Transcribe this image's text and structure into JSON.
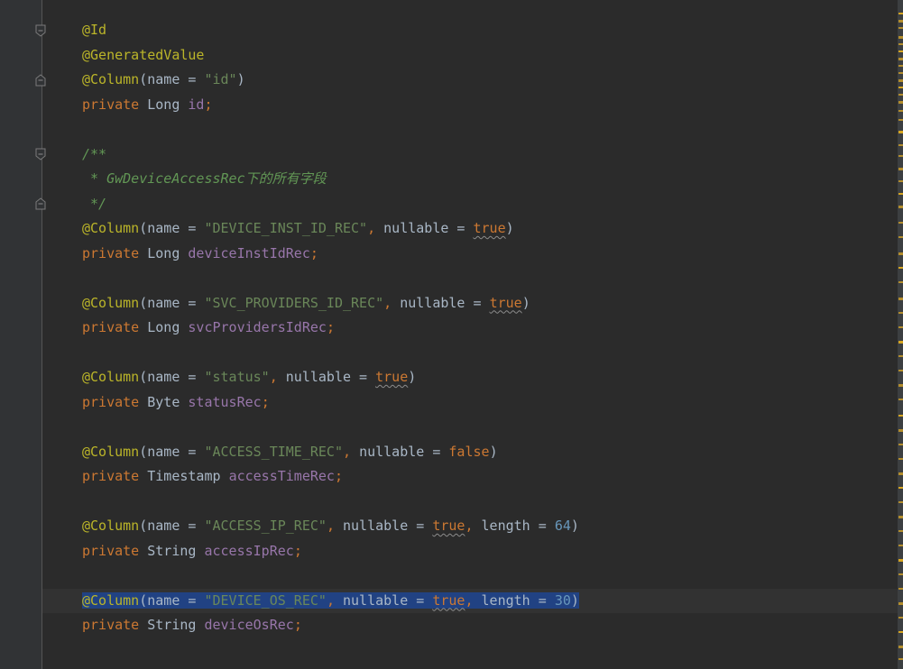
{
  "editor": {
    "lines": [
      {
        "caret": false,
        "tokens": [
          {
            "t": "@Id",
            "c": "ann"
          }
        ]
      },
      {
        "caret": false,
        "tokens": [
          {
            "t": "@GeneratedValue",
            "c": "ann"
          }
        ]
      },
      {
        "caret": false,
        "tokens": [
          {
            "t": "@Column",
            "c": "ann"
          },
          {
            "t": "(name = "
          },
          {
            "t": "\"id\"",
            "c": "str"
          },
          {
            "t": ")"
          }
        ]
      },
      {
        "caret": false,
        "tokens": [
          {
            "t": "private",
            "c": "kw"
          },
          {
            "t": " Long "
          },
          {
            "t": "id",
            "c": "fld"
          },
          {
            "t": ";",
            "c": "punc"
          }
        ]
      },
      {
        "caret": false,
        "tokens": []
      },
      {
        "caret": false,
        "tokens": [
          {
            "t": "/**",
            "c": "cmt"
          }
        ]
      },
      {
        "caret": false,
        "tokens": [
          {
            "t": " * GwDeviceAccessRec下的所有字段",
            "c": "cmt"
          }
        ]
      },
      {
        "caret": false,
        "tokens": [
          {
            "t": " */",
            "c": "cmt"
          }
        ]
      },
      {
        "caret": false,
        "tokens": [
          {
            "t": "@Column",
            "c": "ann"
          },
          {
            "t": "(name = "
          },
          {
            "t": "\"DEVICE_INST_ID_REC\"",
            "c": "str"
          },
          {
            "t": ", ",
            "c": "punc"
          },
          {
            "t": "nullable = "
          },
          {
            "t": "true",
            "c": "kw warn"
          },
          {
            "t": ")"
          }
        ]
      },
      {
        "caret": false,
        "tokens": [
          {
            "t": "private",
            "c": "kw"
          },
          {
            "t": " Long "
          },
          {
            "t": "deviceInstIdRec",
            "c": "fld"
          },
          {
            "t": ";",
            "c": "punc"
          }
        ]
      },
      {
        "caret": false,
        "tokens": []
      },
      {
        "caret": false,
        "tokens": [
          {
            "t": "@Column",
            "c": "ann"
          },
          {
            "t": "(name = "
          },
          {
            "t": "\"SVC_PROVIDERS_ID_REC\"",
            "c": "str"
          },
          {
            "t": ", ",
            "c": "punc"
          },
          {
            "t": "nullable = "
          },
          {
            "t": "true",
            "c": "kw warn"
          },
          {
            "t": ")"
          }
        ]
      },
      {
        "caret": false,
        "tokens": [
          {
            "t": "private",
            "c": "kw"
          },
          {
            "t": " Long "
          },
          {
            "t": "svcProvidersIdRec",
            "c": "fld"
          },
          {
            "t": ";",
            "c": "punc"
          }
        ]
      },
      {
        "caret": false,
        "tokens": []
      },
      {
        "caret": false,
        "tokens": [
          {
            "t": "@Column",
            "c": "ann"
          },
          {
            "t": "(name = "
          },
          {
            "t": "\"status\"",
            "c": "str"
          },
          {
            "t": ", ",
            "c": "punc"
          },
          {
            "t": "nullable = "
          },
          {
            "t": "true",
            "c": "kw warn"
          },
          {
            "t": ")"
          }
        ]
      },
      {
        "caret": false,
        "tokens": [
          {
            "t": "private",
            "c": "kw"
          },
          {
            "t": " Byte "
          },
          {
            "t": "statusRec",
            "c": "fld"
          },
          {
            "t": ";",
            "c": "punc"
          }
        ]
      },
      {
        "caret": false,
        "tokens": []
      },
      {
        "caret": false,
        "tokens": [
          {
            "t": "@Column",
            "c": "ann"
          },
          {
            "t": "(name = "
          },
          {
            "t": "\"ACCESS_TIME_REC\"",
            "c": "str"
          },
          {
            "t": ", ",
            "c": "punc"
          },
          {
            "t": "nullable = "
          },
          {
            "t": "false",
            "c": "kw"
          },
          {
            "t": ")"
          }
        ]
      },
      {
        "caret": false,
        "tokens": [
          {
            "t": "private",
            "c": "kw"
          },
          {
            "t": " Timestamp "
          },
          {
            "t": "accessTimeRec",
            "c": "fld"
          },
          {
            "t": ";",
            "c": "punc"
          }
        ]
      },
      {
        "caret": false,
        "tokens": []
      },
      {
        "caret": false,
        "tokens": [
          {
            "t": "@Column",
            "c": "ann"
          },
          {
            "t": "(name = "
          },
          {
            "t": "\"ACCESS_IP_REC\"",
            "c": "str"
          },
          {
            "t": ", ",
            "c": "punc"
          },
          {
            "t": "nullable = "
          },
          {
            "t": "true",
            "c": "kw warn"
          },
          {
            "t": ", ",
            "c": "punc"
          },
          {
            "t": "length = "
          },
          {
            "t": "64",
            "c": "num"
          },
          {
            "t": ")"
          }
        ]
      },
      {
        "caret": false,
        "tokens": [
          {
            "t": "private",
            "c": "kw"
          },
          {
            "t": " String "
          },
          {
            "t": "accessIpRec",
            "c": "fld"
          },
          {
            "t": ";",
            "c": "punc"
          }
        ]
      },
      {
        "caret": false,
        "tokens": []
      },
      {
        "caret": true,
        "selected": true,
        "tokens": [
          {
            "t": "@Column",
            "c": "ann"
          },
          {
            "t": "(name = "
          },
          {
            "t": "\"DEVICE_OS_REC\"",
            "c": "str"
          },
          {
            "t": ", ",
            "c": "punc"
          },
          {
            "t": "nullable = "
          },
          {
            "t": "true",
            "c": "kw warn"
          },
          {
            "t": ", ",
            "c": "punc"
          },
          {
            "t": "length = "
          },
          {
            "t": "30",
            "c": "num"
          },
          {
            "t": ")"
          }
        ]
      },
      {
        "caret": false,
        "tokens": [
          {
            "t": "private",
            "c": "kw"
          },
          {
            "t": " String "
          },
          {
            "t": "deviceOsRec",
            "c": "fld"
          },
          {
            "t": ";",
            "c": "punc"
          }
        ]
      }
    ],
    "fold_markers": [
      {
        "line": 0,
        "kind": "open"
      },
      {
        "line": 2,
        "kind": "close"
      },
      {
        "line": 5,
        "kind": "open"
      },
      {
        "line": 7,
        "kind": "close"
      }
    ]
  },
  "colors": {
    "background": "#2b2b2b",
    "gutter": "#313335",
    "selection": "#214283",
    "keyword": "#cc7832",
    "annotation": "#bbb529",
    "string": "#6a8759",
    "field": "#9876aa",
    "number": "#6897bb",
    "comment": "#629755",
    "scroll_marker": "#b38d2c"
  }
}
